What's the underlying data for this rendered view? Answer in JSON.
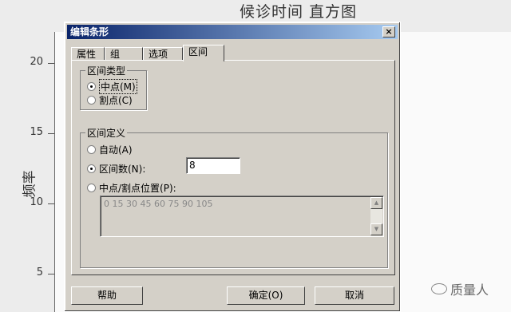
{
  "background_chart": {
    "title": "候诊时间 直方图",
    "ylabel": "频率",
    "yticks": [
      "20",
      "15",
      "10",
      "5"
    ]
  },
  "dialog": {
    "title": "编辑条形",
    "close_label": "×",
    "tabs": [
      {
        "label": "属性",
        "active": false
      },
      {
        "label": "组",
        "active": false
      },
      {
        "label": "选项",
        "active": false
      },
      {
        "label": "区间",
        "active": true
      }
    ],
    "interval_type": {
      "label": "区间类型",
      "options": [
        {
          "label": "中点(M)",
          "checked": true
        },
        {
          "label": "割点(C)",
          "checked": false
        }
      ]
    },
    "interval_definition": {
      "label": "区间定义",
      "options": [
        {
          "label": "自动(A)",
          "checked": false
        },
        {
          "label": "区间数(N):",
          "checked": true
        },
        {
          "label": "中点/割点位置(P):",
          "checked": false
        }
      ],
      "interval_count": "8",
      "positions": "0 15 30 45 60 75 90 105"
    },
    "buttons": {
      "help": "帮助",
      "ok": "确定(O)",
      "cancel": "取消"
    }
  },
  "watermark": {
    "text": "质量人"
  }
}
